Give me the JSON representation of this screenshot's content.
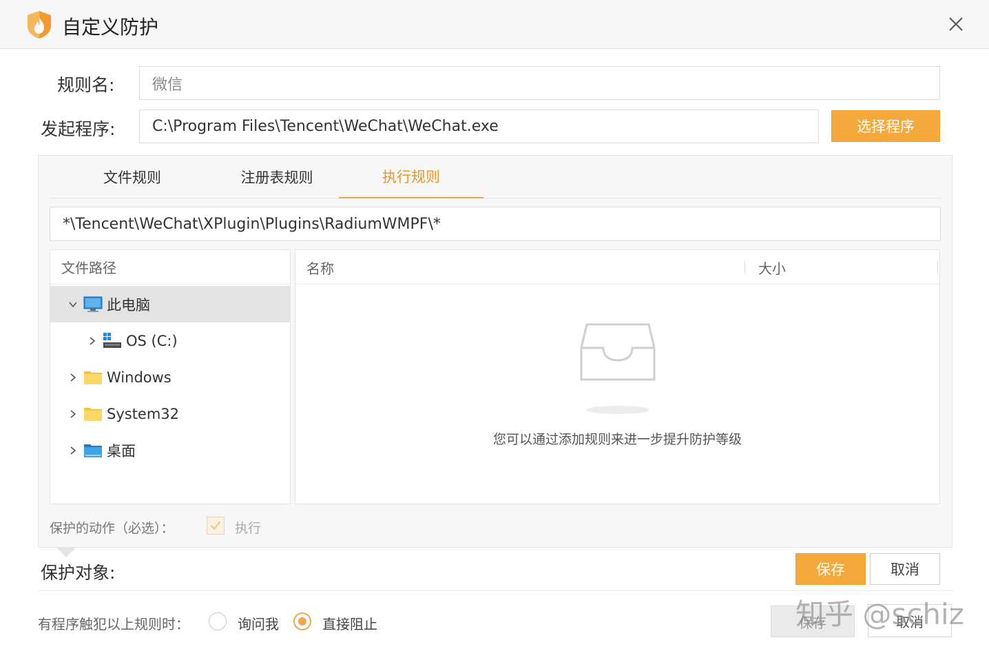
{
  "window": {
    "title": "自定义防护"
  },
  "form": {
    "rule_name_label": "规则名:",
    "rule_name_placeholder": "微信",
    "program_label": "发起程序:",
    "program_path": "C:\\Program Files\\Tencent\\WeChat\\WeChat.exe",
    "select_program_button": "选择程序"
  },
  "tabs": [
    {
      "label": "文件规则",
      "active": false
    },
    {
      "label": "注册表规则",
      "active": false
    },
    {
      "label": "执行规则",
      "active": true
    }
  ],
  "pattern_value": "*\\Tencent\\WeChat\\XPlugin\\Plugins\\RadiumWMPF\\*",
  "tree": {
    "header": "文件路径",
    "items": [
      {
        "label": "此电脑",
        "icon": "computer-icon",
        "expanded": true,
        "selected": true
      },
      {
        "label": "OS (C:)",
        "icon": "drive-icon",
        "expanded": false,
        "selected": false
      },
      {
        "label": "Windows",
        "icon": "folder-icon",
        "expanded": false,
        "selected": false
      },
      {
        "label": "System32",
        "icon": "folder-icon",
        "expanded": false,
        "selected": false
      },
      {
        "label": "桌面",
        "icon": "desktop-folder-icon",
        "expanded": false,
        "selected": false
      }
    ]
  },
  "list": {
    "col_name": "名称",
    "col_size": "大小",
    "empty_text": "您可以通过添加规则来进一步提升防护等级"
  },
  "action": {
    "label": "保护的动作（必选）：",
    "checkbox_label": "执行",
    "checked": true
  },
  "protect_target": {
    "label": "保护对象:",
    "save_button": "保存",
    "cancel_button": "取消"
  },
  "trigger": {
    "label": "有程序触犯以上规则时：",
    "option_ask": "询问我",
    "option_block": "直接阻止",
    "selected": "直接阻止"
  },
  "footer": {
    "save_button": "保存",
    "cancel_button": "取消"
  },
  "watermark": "知乎 @schiz",
  "colors": {
    "accent": "#f5a93b",
    "tab_active": "#e9962a"
  }
}
